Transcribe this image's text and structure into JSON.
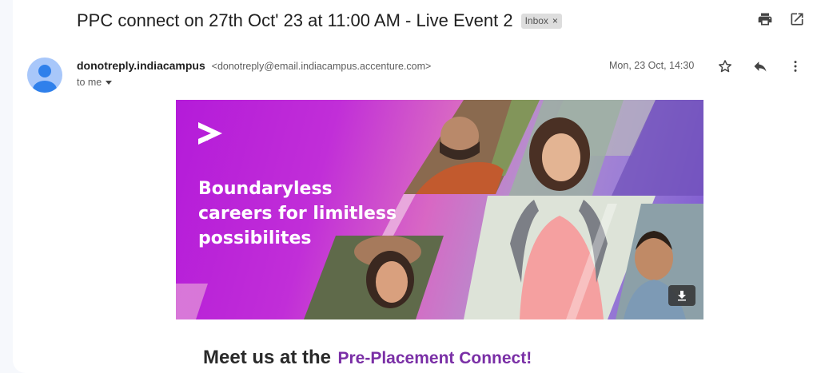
{
  "email": {
    "subject": "PPC connect on 27th Oct' 23 at 11:00 AM - Live Event 2",
    "label": "Inbox",
    "label_remove": "×",
    "sender_name": "donotreply.indiacampus",
    "sender_email": "<donotreply@email.indiacampus.accenture.com>",
    "recipient": "to me",
    "date": "Mon, 23 Oct, 14:30"
  },
  "banner": {
    "line1": "Boundaryless",
    "line2": "careers for limitless",
    "line3": "possibilites"
  },
  "body": {
    "headline_prefix": "Meet us at the",
    "headline_highlight": "Pre-Placement Connect!"
  },
  "icons": {
    "print": "print-icon",
    "open_new_window": "open-in-new-icon",
    "star": "star-icon",
    "reply": "reply-icon",
    "more": "more-vert-icon",
    "download": "download-icon",
    "brand": "accenture-logo"
  },
  "colors": {
    "banner_purple": "#b41bd9",
    "headline_purple": "#7a2fa6"
  }
}
